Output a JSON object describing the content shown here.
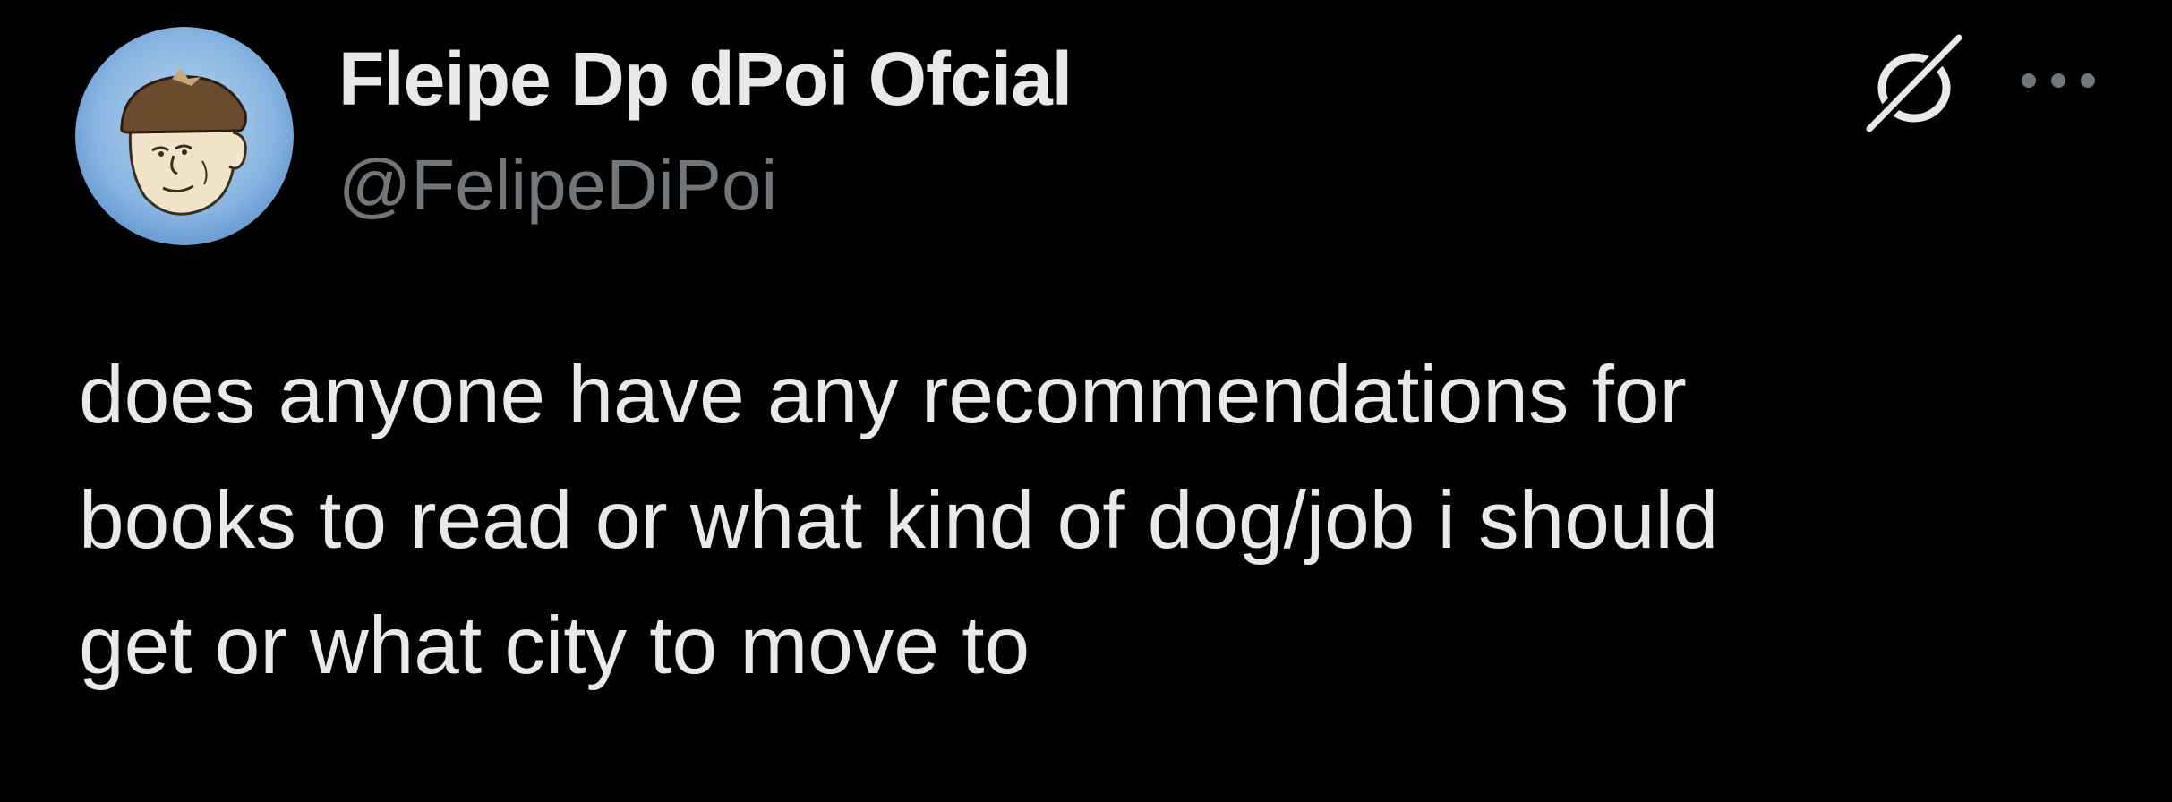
{
  "tweet": {
    "author": {
      "display_name": "Fleipe Dp dPoi Ofcial",
      "handle": "@FelipeDiPoi",
      "avatar_icon": "cartoon-face-avatar"
    },
    "actions": {
      "grok_icon": "grok-slash-icon",
      "more_icon": "more-dots-icon"
    },
    "text": "does anyone have any recommendations for\nbooks to read or what kind of dog/job i should\nget or what city to move to"
  },
  "colors": {
    "background": "#000000",
    "primary_text": "#e7e9ea",
    "secondary_text": "#71767b",
    "avatar_ring": "#6aa0d8"
  }
}
